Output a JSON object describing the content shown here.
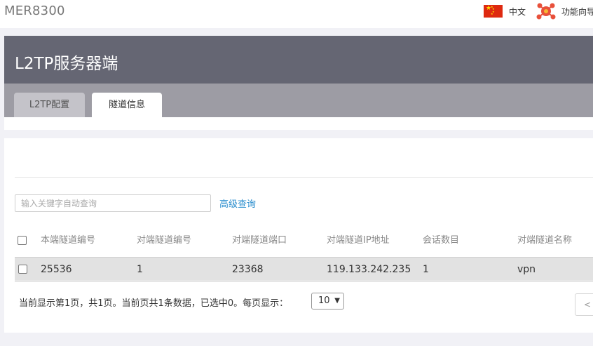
{
  "header": {
    "brand": "MER8300",
    "language": "中文",
    "wizard": "功能向导"
  },
  "page": {
    "title": "L2TP服务器端",
    "tabs": [
      {
        "label": "L2TP配置",
        "active": false
      },
      {
        "label": "隧道信息",
        "active": true
      }
    ]
  },
  "search": {
    "placeholder": "输入关键字自动查询",
    "value": "",
    "advanced_label": "高级查询"
  },
  "table": {
    "columns": [
      "本端隧道编号",
      "对端隧道编号",
      "对端隧道端口",
      "对端隧道IP地址",
      "会话数目",
      "对端隧道名称"
    ],
    "rows": [
      {
        "local_id": "25536",
        "peer_id": "1",
        "peer_port": "23368",
        "peer_ip": "119.133.242.235",
        "sessions": "1",
        "peer_name": "vpn"
      }
    ]
  },
  "pagination": {
    "summary": "当前显示第1页，共1页。当前页共1条数据，已选中0。每页显示：",
    "page_size": "10",
    "prev_label": "<"
  },
  "colors": {
    "header_panel": "#656673",
    "tabstrip": "#9d9ca4",
    "link": "#2d8fce",
    "row_bg": "#e2e2e2"
  }
}
